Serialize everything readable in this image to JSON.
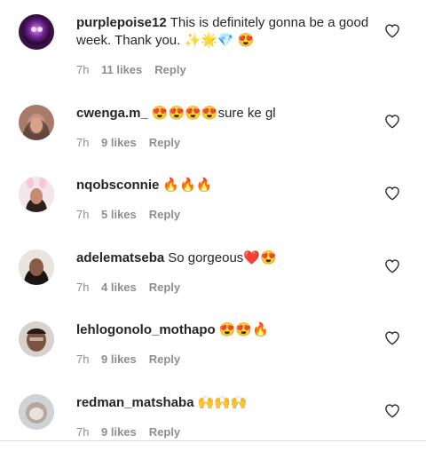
{
  "comments": [
    {
      "username": "purplepoise12",
      "text": "This is definitely gonna be a good week. Thank you. ✨🌟💎 😍",
      "time": "7h",
      "likes": "11 likes",
      "reply": "Reply",
      "avatar_icon": "purple-orb-avatar"
    },
    {
      "username": "cwenga.m_",
      "text": "😍😍😍😍sure ke gl",
      "time": "7h",
      "likes": "9 likes",
      "reply": "Reply",
      "avatar_icon": "user-photo-avatar"
    },
    {
      "username": "nqobsconnie",
      "text": "🔥🔥🔥",
      "time": "7h",
      "likes": "5 likes",
      "reply": "Reply",
      "avatar_icon": "user-photo-avatar"
    },
    {
      "username": "adelematseba",
      "text": "So gorgeous❤️😍",
      "time": "7h",
      "likes": "4 likes",
      "reply": "Reply",
      "avatar_icon": "user-photo-avatar"
    },
    {
      "username": "lehlogonolo_mothapo",
      "text": "😍😍🔥",
      "time": "7h",
      "likes": "9 likes",
      "reply": "Reply",
      "avatar_icon": "user-photo-avatar"
    },
    {
      "username": "redman_matshaba",
      "text": "🙌🙌🙌",
      "time": "7h",
      "likes": "9 likes",
      "reply": "Reply",
      "avatar_icon": "user-photo-avatar"
    }
  ],
  "colors": {
    "text": "#262626",
    "meta": "#8e8e8e",
    "heart_outline": "#262626"
  }
}
